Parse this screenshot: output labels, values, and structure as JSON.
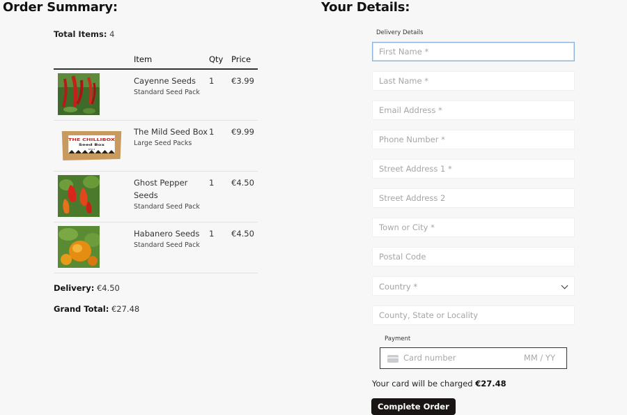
{
  "order": {
    "heading": "Order Summary:",
    "total_items_label": "Total Items:",
    "total_items_value": "4",
    "columns": {
      "item": "Item",
      "qty": "Qty",
      "price": "Price"
    },
    "items": [
      {
        "name": "Cayenne Seeds",
        "size": "Standard Seed Pack",
        "qty": "1",
        "price": "€3.99"
      },
      {
        "name": "The Mild Seed Box",
        "size": "Large Seed Packs",
        "qty": "1",
        "price": "€9.99",
        "box_text_1": "THE CHILLIBOX",
        "box_text_2": "Seed Box",
        "box_text_3": "Mild"
      },
      {
        "name": "Ghost Pepper Seeds",
        "size": "Standard Seed Pack",
        "qty": "1",
        "price": "€4.50"
      },
      {
        "name": "Habanero Seeds",
        "size": "Standard Seed Pack",
        "qty": "1",
        "price": "€4.50"
      }
    ],
    "delivery_label": "Delivery:",
    "delivery_value": "€4.50",
    "grand_total_label": "Grand Total:",
    "grand_total_value": "€27.48"
  },
  "details": {
    "heading": "Your Details:",
    "delivery_section_label": "Delivery Details",
    "fields": {
      "first_name": "First Name *",
      "last_name": "Last Name *",
      "email": "Email Address *",
      "phone": "Phone Number *",
      "street1": "Street Address 1 *",
      "street2": "Street Address 2",
      "town": "Town or City *",
      "postal": "Postal Code",
      "country": "Country *",
      "county": "County, State or Locality"
    },
    "payment_label": "Payment",
    "card_number_placeholder": "Card number",
    "card_expiry_placeholder": "MM / YY",
    "charge_text": "Your card will be charged",
    "charge_amount": "€27.48",
    "submit_label": "Complete Order"
  },
  "colors": {
    "button_bg": "#1a1515",
    "focus_border": "#8db4d8"
  }
}
